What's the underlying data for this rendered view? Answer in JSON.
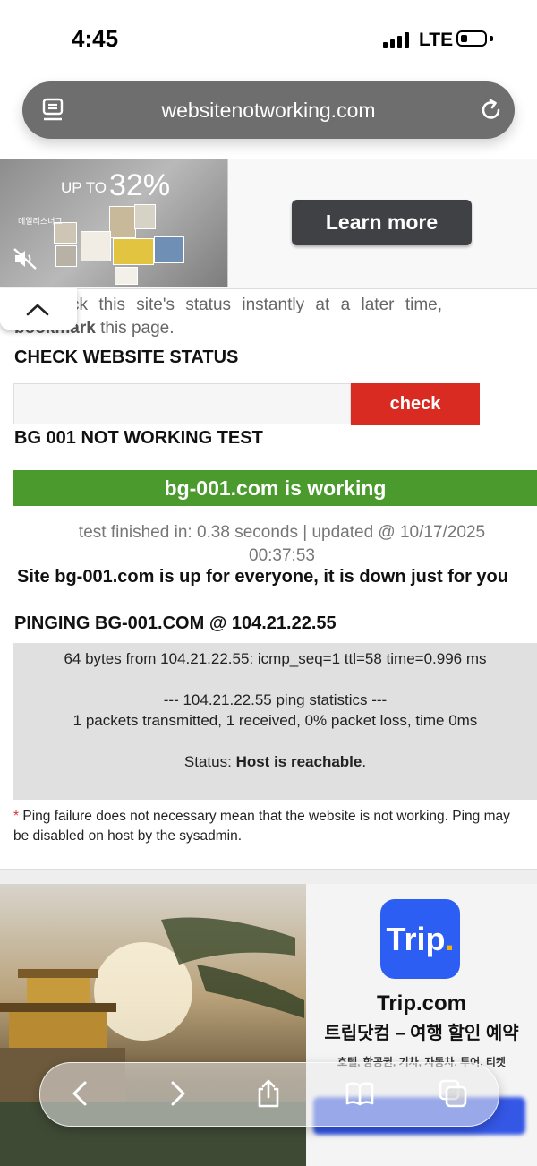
{
  "status_bar": {
    "time": "4:45",
    "network": "LTE",
    "battery_level": 0.25
  },
  "url_bar": {
    "url": "websitenotworking.com"
  },
  "top_ad": {
    "promo_prefix": "UP TO",
    "promo_value": "32%",
    "brand_text": "데일리스너그",
    "cta_label": "Learn more"
  },
  "intro": {
    "text_before": "To check this site's status instantly at a later time,",
    "bold": "bookmark",
    "text_after": "this page."
  },
  "check_section": {
    "heading": "CHECK WEBSITE STATUS",
    "input_value": "",
    "button_label": "check"
  },
  "test_section": {
    "heading": "BG 001 NOT WORKING TEST",
    "result": "bg-001.com is working",
    "finished_line": "test finished in: 0.38 seconds | updated @ 10/17/2025",
    "finished_line2": "00:37:53",
    "site_status": "Site bg-001.com is up for everyone, it is down just for you"
  },
  "ping_section": {
    "heading": "PINGING BG-001.COM @ 104.21.22.55",
    "line1": "64 bytes from 104.21.22.55: icmp_seq=1 ttl=58 time=0.996 ms",
    "line2": "--- 104.21.22.55 ping statistics ---",
    "line3": "1 packets transmitted, 1 received, 0% packet loss, time 0ms",
    "status_label": "Status:",
    "status_value": "Host is reachable",
    "note_star": "*",
    "note": "Ping failure does not necessary mean that the website is not working. Ping may be disabled on host by the sysadmin."
  },
  "bottom_ad": {
    "logo_text": "Trip",
    "logo_dot": ".",
    "brand": "Trip.com",
    "tagline": "트립닷컴 – 여행 할인 예약",
    "sub": "호텔, 항공권, 기차, 자동차, 투어, 티켓",
    "accent_color": "#2d5ef3"
  },
  "toolbar": {
    "back": "back-icon",
    "forward": "forward-icon",
    "share": "share-icon",
    "bookmarks": "bookmarks-icon",
    "tabs": "tabs-icon"
  }
}
